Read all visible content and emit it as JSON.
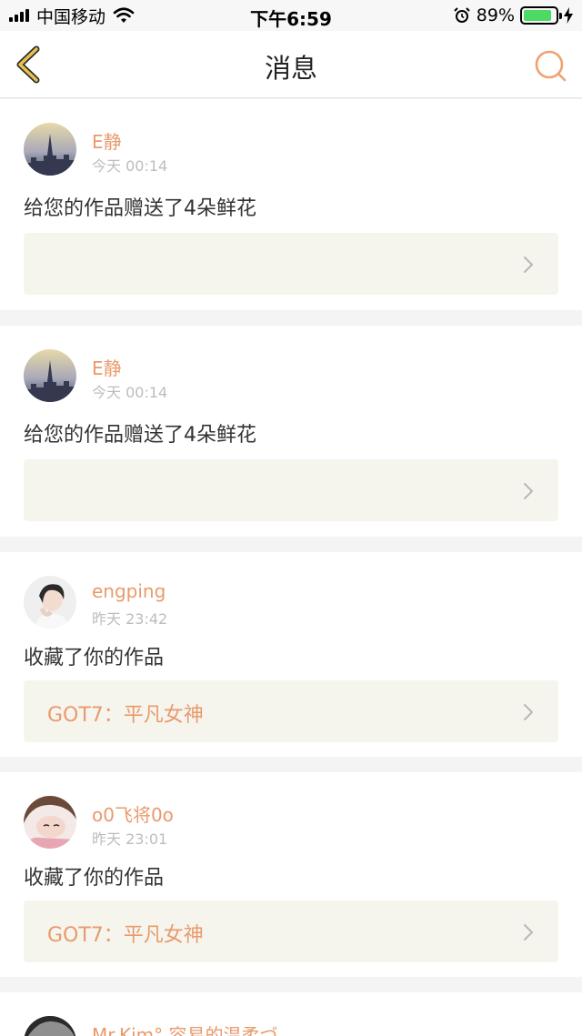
{
  "status_bar": {
    "carrier": "中国移动",
    "time": "下午6:59",
    "battery_percent": "89%",
    "battery_level": 0.89
  },
  "nav": {
    "title": "消息",
    "back_icon": "chevron-left-icon",
    "search_icon": "search-icon"
  },
  "messages": [
    {
      "username": "E静",
      "time": "今天 00:14",
      "text": "给您的作品赠送了4朵鲜花",
      "work_title": ""
    },
    {
      "username": "E静",
      "time": "今天 00:14",
      "text": "给您的作品赠送了4朵鲜花",
      "work_title": ""
    },
    {
      "username": "engping",
      "time": "昨天 23:42",
      "text": "收藏了你的作品",
      "work_title": "GOT7：平凡女神"
    },
    {
      "username": "o0飞将0o",
      "time": "昨天 23:01",
      "text": "收藏了你的作品",
      "work_title": "GOT7：平凡女神"
    }
  ],
  "partial_message": {
    "username": "Mr.Kim° 容易的温柔づ"
  },
  "colors": {
    "accent": "#e99a6c",
    "back_icon": "#e8c24a",
    "link_bg": "#f5f5ee"
  }
}
